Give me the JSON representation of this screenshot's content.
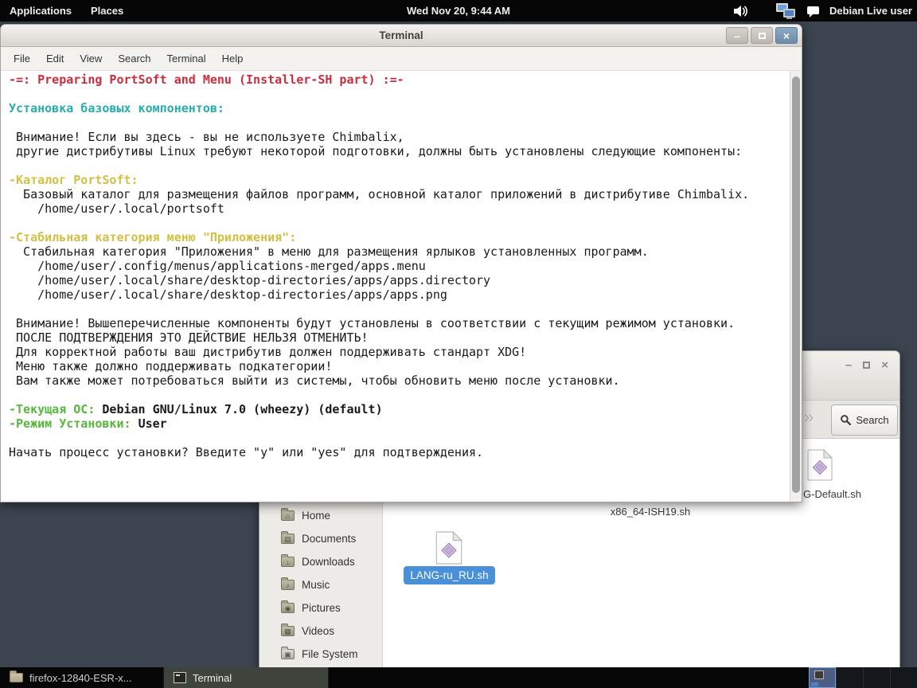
{
  "colors": {
    "desktop": "#3c4450",
    "selection_blue": "#4a90d9",
    "terminal_red": "#cb2d3e",
    "terminal_cyan": "#2aacae",
    "terminal_yellow": "#d2c044",
    "terminal_green": "#58b73c"
  },
  "icons": {
    "volume": "speaker-with-waves",
    "network": "two-computers",
    "user": "chat-bubble",
    "search": "magnifier",
    "chevron": "»",
    "sidebar_folders": "folder",
    "script_file": "page-with-purple-diamond"
  },
  "top_bar": {
    "menus": [
      {
        "id": "applications",
        "label": "Applications"
      },
      {
        "id": "places",
        "label": "Places"
      }
    ],
    "clock": "Wed Nov 20,  9:44 AM",
    "user": "Debian Live user"
  },
  "terminal": {
    "title": "Terminal",
    "menu_items": [
      "File",
      "Edit",
      "View",
      "Search",
      "Terminal",
      "Help"
    ],
    "lines": [
      {
        "segs": [
          {
            "t": "-=: Preparing PortSoft and Menu (Installer-SH part) :=-",
            "c": "red",
            "b": true
          }
        ]
      },
      {
        "segs": []
      },
      {
        "segs": [
          {
            "t": "Установка базовых компонентов:",
            "c": "cyan",
            "b": true
          }
        ]
      },
      {
        "segs": []
      },
      {
        "segs": [
          {
            "t": " Внимание! Если вы здесь - вы не используете Chimbalix,",
            "c": "fg"
          }
        ]
      },
      {
        "segs": [
          {
            "t": " другие дистрибутивы Linux требуют некоторой подготовки, должны быть установлены следующие компоненты:",
            "c": "fg"
          }
        ]
      },
      {
        "segs": []
      },
      {
        "segs": [
          {
            "t": "-Каталог PortSoft:",
            "c": "yellow",
            "b": true
          }
        ]
      },
      {
        "segs": [
          {
            "t": "  Базовый каталог для размещения файлов программ, основной каталог приложений в дистрибутиве Chimbalix.",
            "c": "fg"
          }
        ]
      },
      {
        "segs": [
          {
            "t": "    /home/user/.local/portsoft",
            "c": "fg"
          }
        ]
      },
      {
        "segs": []
      },
      {
        "segs": [
          {
            "t": "-Стабильная категория меню \"Приложения\":",
            "c": "yellow",
            "b": true
          }
        ]
      },
      {
        "segs": [
          {
            "t": "  Стабильная категория \"Приложения\" в меню для размещения ярлыков установленных программ.",
            "c": "fg"
          }
        ]
      },
      {
        "segs": [
          {
            "t": "    /home/user/.config/menus/applications-merged/apps.menu",
            "c": "fg"
          }
        ]
      },
      {
        "segs": [
          {
            "t": "    /home/user/.local/share/desktop-directories/apps/apps.directory",
            "c": "fg"
          }
        ]
      },
      {
        "segs": [
          {
            "t": "    /home/user/.local/share/desktop-directories/apps/apps.png",
            "c": "fg"
          }
        ]
      },
      {
        "segs": []
      },
      {
        "segs": [
          {
            "t": " Внимание! Вышеперечисленные компоненты будут установлены в соответствии с текущим режимом установки.",
            "c": "fg"
          }
        ]
      },
      {
        "segs": [
          {
            "t": " ПОСЛЕ ПОДТВЕРЖДЕНИЯ ЭТО ДЕЙСТВИЕ НЕЛЬЗЯ ОТМЕНИТЬ!",
            "c": "fg"
          }
        ]
      },
      {
        "segs": [
          {
            "t": " Для корректной работы ваш дистрибутив должен поддерживать стандарт XDG!",
            "c": "fg"
          }
        ]
      },
      {
        "segs": [
          {
            "t": " Меню также должно поддерживать подкатегории!",
            "c": "fg"
          }
        ]
      },
      {
        "segs": [
          {
            "t": " Вам также может потребоваться выйти из системы, чтобы обновить меню после установки.",
            "c": "fg"
          }
        ]
      },
      {
        "segs": []
      },
      {
        "segs": [
          {
            "t": "-Текущая ОС: ",
            "c": "green",
            "b": true
          },
          {
            "t": "Debian GNU/Linux 7.0 (wheezy) (default)",
            "c": "fg",
            "b": true
          }
        ]
      },
      {
        "segs": [
          {
            "t": "-Режим Установки: ",
            "c": "green",
            "b": true
          },
          {
            "t": "User",
            "c": "fg",
            "b": true
          }
        ]
      },
      {
        "segs": []
      },
      {
        "segs": [
          {
            "t": "Начать процесс установки? Введите \"y\" или \"yes\" для подтверждения.",
            "c": "fg"
          }
        ]
      }
    ]
  },
  "file_manager": {
    "toolbar": {
      "search_label": "Search"
    },
    "sidebar": {
      "items": [
        {
          "label": "Home",
          "glyph": "⌂",
          "type": "folder"
        },
        {
          "label": "Documents",
          "glyph": "▤",
          "type": "folder"
        },
        {
          "label": "Downloads",
          "glyph": "↓",
          "type": "folder"
        },
        {
          "label": "Music",
          "glyph": "♪",
          "type": "folder"
        },
        {
          "label": "Pictures",
          "glyph": "◉",
          "type": "folder"
        },
        {
          "label": "Videos",
          "glyph": "▦",
          "type": "folder"
        },
        {
          "label": "File System",
          "glyph": "▣",
          "type": "drive"
        }
      ]
    },
    "files": {
      "ish": {
        "label": "x86_64-ISH19.sh",
        "selected": false
      },
      "default_file": {
        "label": "G-Default.sh",
        "selected": false
      },
      "lang": {
        "label": "LANG-ru_RU.sh",
        "selected": true
      }
    }
  },
  "taskbar": {
    "buttons": [
      {
        "label": "firefox-12840-ESR-x...",
        "icon": "folder-icon",
        "active": false
      },
      {
        "label": "Terminal",
        "icon": "terminal-icon",
        "active": true
      }
    ],
    "workspaces": {
      "count": 4,
      "active": 0
    }
  }
}
